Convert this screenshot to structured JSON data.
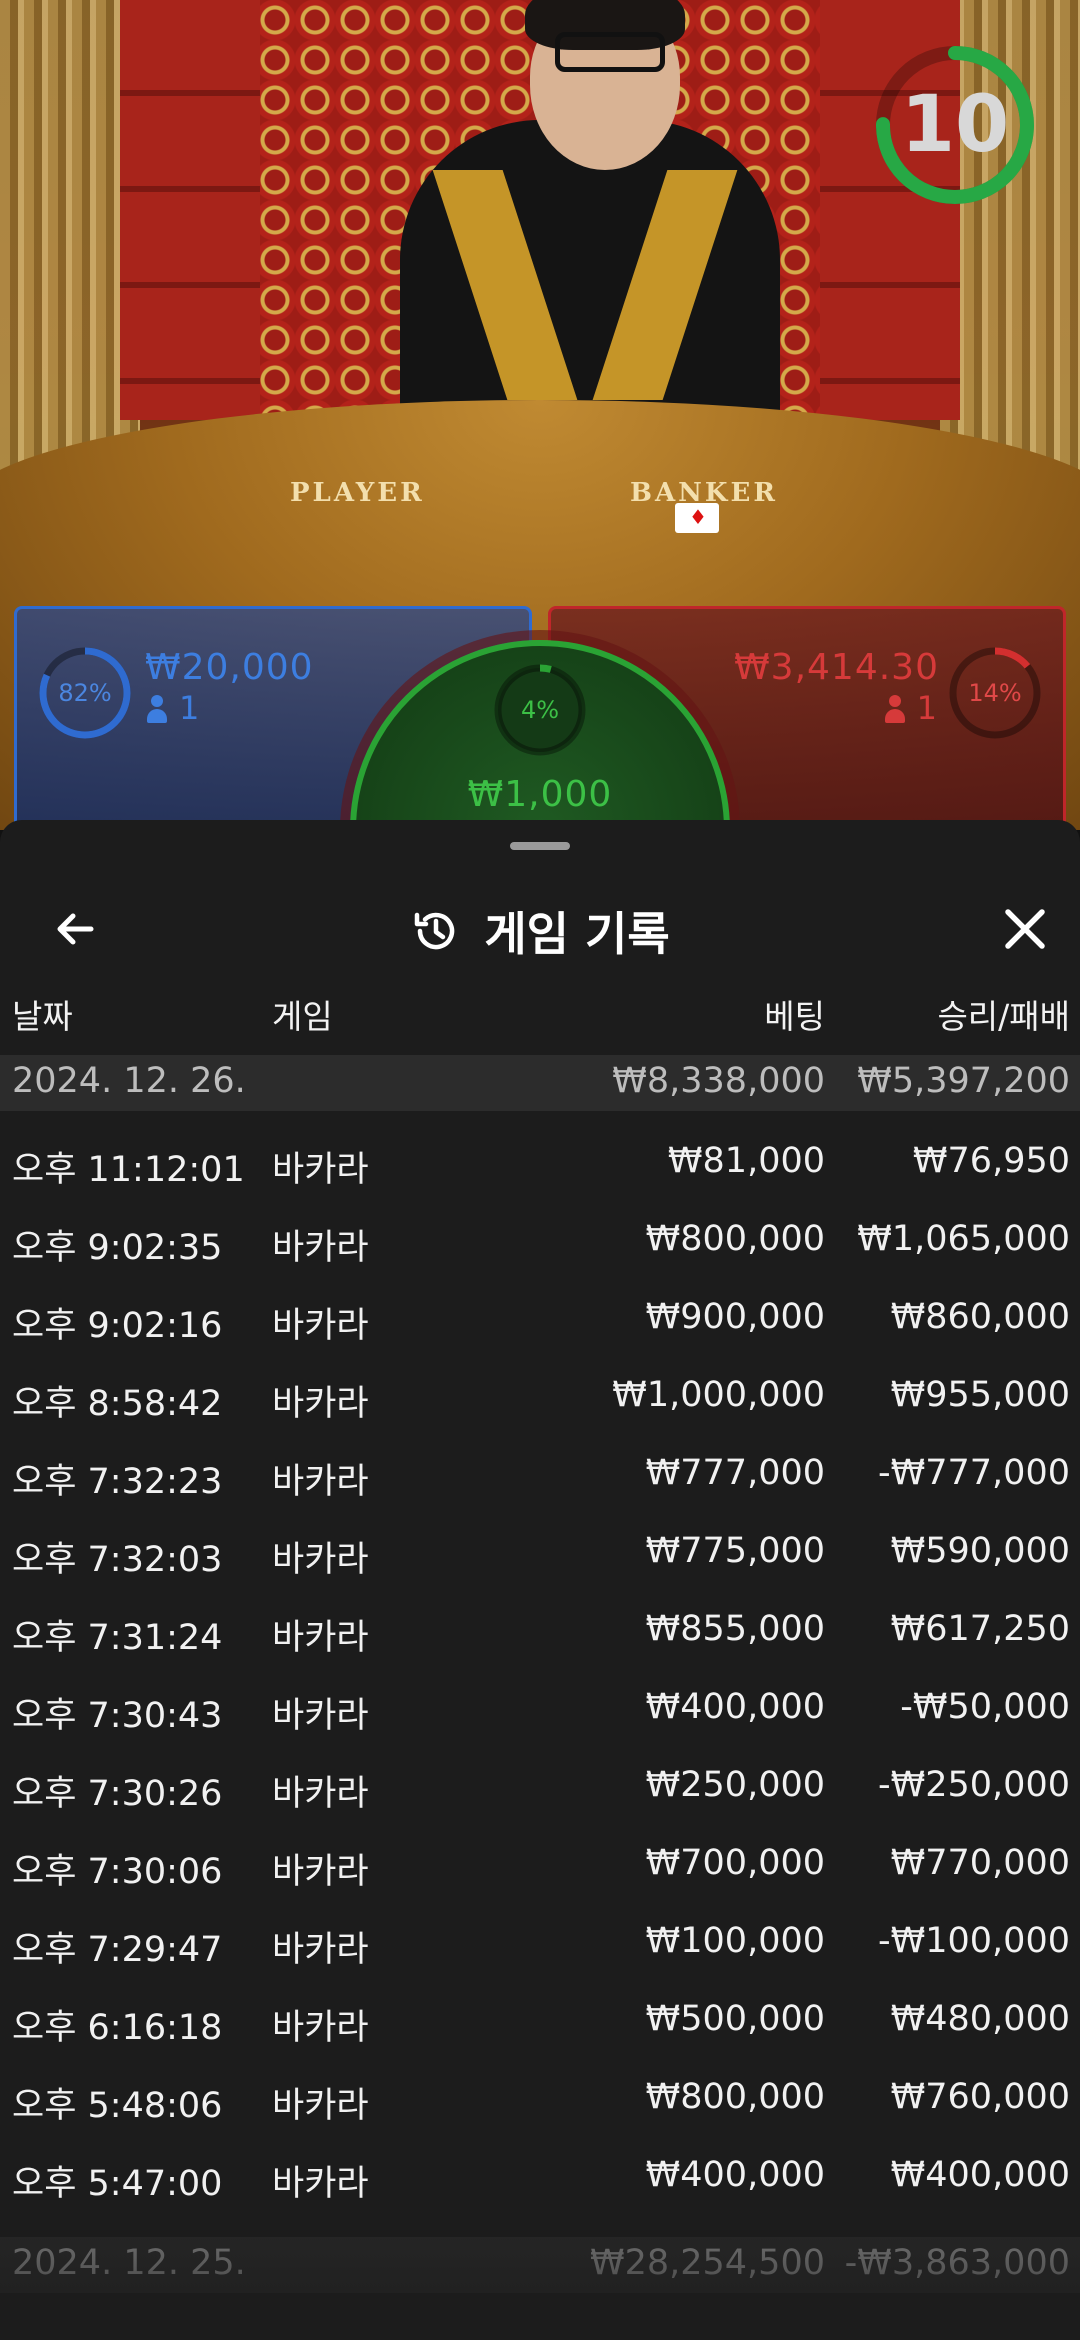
{
  "video": {
    "timer": "10",
    "table_labels": {
      "player": "PLAYER",
      "banker": "BANKER"
    },
    "player_bet": {
      "percent": "82%",
      "percent_value": 0.82,
      "amount": "₩20,000",
      "players": "1"
    },
    "banker_bet": {
      "percent": "14%",
      "percent_value": 0.14,
      "amount": "₩3,414.30",
      "players": "1"
    },
    "tie_bet": {
      "percent": "4%",
      "percent_value": 0.04,
      "amount": "₩1,000"
    },
    "colors": {
      "player": "#2f6bd0",
      "banker": "#c0262a",
      "tie": "#2aa334",
      "timer": "#27a845"
    }
  },
  "sheet": {
    "title": "게임 기록",
    "icons": {
      "back": "arrow-left-icon",
      "history": "history-icon",
      "close": "close-icon"
    },
    "columns": {
      "date": "날짜",
      "game": "게임",
      "bet": "베팅",
      "result": "승리/패배"
    },
    "groups": [
      {
        "date": "2024. 12. 26.",
        "bet_total": "₩8,338,000",
        "result_total": "₩5,397,200",
        "rows": [
          {
            "time": "오후 11:12:01",
            "game": "바카라",
            "bet": "₩81,000",
            "result": "₩76,950"
          },
          {
            "time": "오후 9:02:35",
            "game": "바카라",
            "bet": "₩800,000",
            "result": "₩1,065,000"
          },
          {
            "time": "오후 9:02:16",
            "game": "바카라",
            "bet": "₩900,000",
            "result": "₩860,000"
          },
          {
            "time": "오후 8:58:42",
            "game": "바카라",
            "bet": "₩1,000,000",
            "result": "₩955,000"
          },
          {
            "time": "오후 7:32:23",
            "game": "바카라",
            "bet": "₩777,000",
            "result": "-₩777,000"
          },
          {
            "time": "오후 7:32:03",
            "game": "바카라",
            "bet": "₩775,000",
            "result": "₩590,000"
          },
          {
            "time": "오후 7:31:24",
            "game": "바카라",
            "bet": "₩855,000",
            "result": "₩617,250"
          },
          {
            "time": "오후 7:30:43",
            "game": "바카라",
            "bet": "₩400,000",
            "result": "-₩50,000"
          },
          {
            "time": "오후 7:30:26",
            "game": "바카라",
            "bet": "₩250,000",
            "result": "-₩250,000"
          },
          {
            "time": "오후 7:30:06",
            "game": "바카라",
            "bet": "₩700,000",
            "result": "₩770,000"
          },
          {
            "time": "오후 7:29:47",
            "game": "바카라",
            "bet": "₩100,000",
            "result": "-₩100,000"
          },
          {
            "time": "오후 6:16:18",
            "game": "바카라",
            "bet": "₩500,000",
            "result": "₩480,000"
          },
          {
            "time": "오후 5:48:06",
            "game": "바카라",
            "bet": "₩800,000",
            "result": "₩760,000"
          },
          {
            "time": "오후 5:47:00",
            "game": "바카라",
            "bet": "₩400,000",
            "result": "₩400,000"
          }
        ]
      },
      {
        "date": "2024. 12. 25.",
        "bet_total": "₩28,254,500",
        "result_total": "-₩3,863,000",
        "rows": []
      }
    ]
  }
}
